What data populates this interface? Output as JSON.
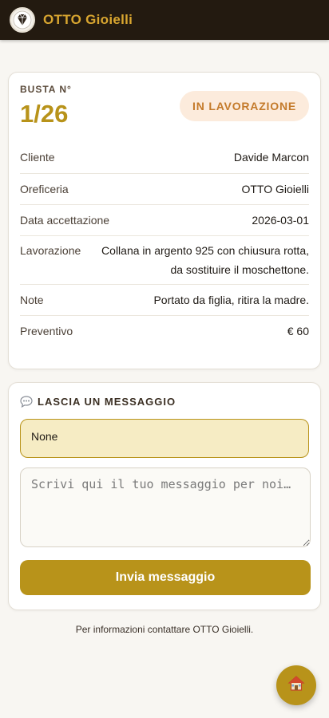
{
  "header": {
    "brand": "OTTO Gioielli",
    "logo_icon": "diamond-logo-icon"
  },
  "ticket": {
    "label": "BUSTA N°",
    "number": "1/26",
    "status": "IN LAVORAZIONE",
    "status_color": "#c47a2a",
    "fields": [
      {
        "key": "Cliente",
        "value": "Davide Marcon"
      },
      {
        "key": "Oreficeria",
        "value": "OTTO Gioielli"
      },
      {
        "key": "Data accettazione",
        "value": "2026-03-01"
      },
      {
        "key": "Lavorazione",
        "value": "Collana in argento 925 con chiusura rotta, da sostituire il moschettone."
      },
      {
        "key": "Note",
        "value": "Portato da figlia, ritira la madre."
      },
      {
        "key": "Preventivo",
        "value": "€ 60"
      }
    ]
  },
  "message": {
    "title": "LASCIA UN MESSAGGIO",
    "title_icon": "speech-bubble-icon",
    "existing": "None",
    "placeholder": "Scrivi qui il tuo messaggio per noi…",
    "send_label": "Invia messaggio"
  },
  "footer": {
    "text": "Per informazioni contattare OTTO Gioielli."
  },
  "fab": {
    "icon": "home-icon"
  },
  "colors": {
    "accent": "#b8931a",
    "header_bg": "#231a10",
    "brand": "#d9a630"
  }
}
